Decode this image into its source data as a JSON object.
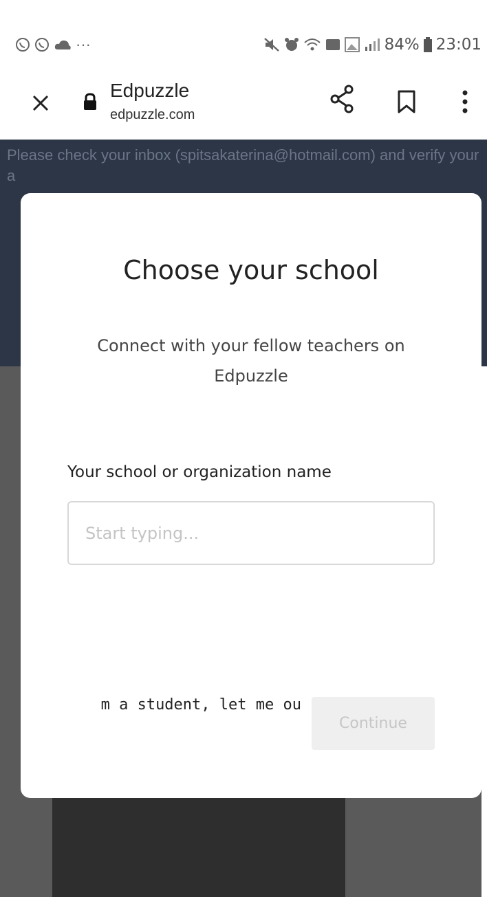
{
  "status_bar": {
    "left_icons": [
      "viber-icon",
      "viber-icon",
      "cloud-icon",
      "more-dots-icon"
    ],
    "more_text": "···",
    "battery": "84%",
    "time": "23:01"
  },
  "browser": {
    "title": "Edpuzzle",
    "url": "edpuzzle.com"
  },
  "banner": {
    "text": "Please check your inbox (spitsakaterina@hotmail.com) and verify your a"
  },
  "modal": {
    "title": "Choose your school",
    "subtitle": "Connect with your fellow teachers on Edpuzzle",
    "field_label": "Your school or organization name",
    "input_value": "",
    "input_placeholder": "Start typing...",
    "student_link": "m a student, let me ou",
    "continue_label": "Continue"
  },
  "colors": {
    "banner_bg": "#2d3646",
    "overlay_bg": "#5a5a5a",
    "continue_disabled_bg": "#efefef",
    "continue_disabled_text": "#c6c6c6"
  }
}
